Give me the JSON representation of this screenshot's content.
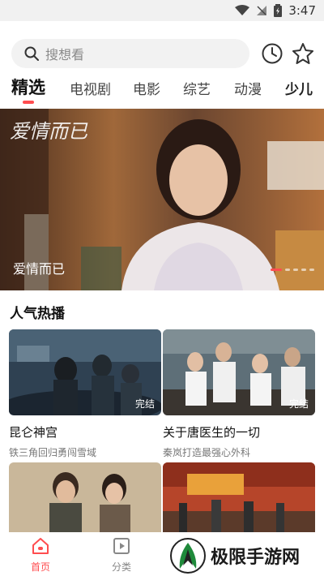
{
  "status_bar": {
    "time": "3:47"
  },
  "search": {
    "placeholder": "搜想看"
  },
  "tabs": [
    {
      "label": "精选",
      "active": true
    },
    {
      "label": "电视剧"
    },
    {
      "label": "电影"
    },
    {
      "label": "综艺"
    },
    {
      "label": "动漫"
    },
    {
      "label": "少儿"
    }
  ],
  "banner": {
    "title": "爱情而已",
    "logo_text": "爱情而已"
  },
  "section": {
    "title": "人气热播"
  },
  "cards": [
    {
      "title": "昆仑神宫",
      "subtitle": "铁三角回归勇闯雪域",
      "badge": "完结"
    },
    {
      "title": "关于唐医生的一切",
      "subtitle": "秦岚打造最强心外科",
      "badge": "完结"
    }
  ],
  "bottom_nav": {
    "home": "首页",
    "category": "分类"
  },
  "watermark": {
    "text": "极限手游网"
  },
  "colors": {
    "accent": "#ff4d4f"
  }
}
